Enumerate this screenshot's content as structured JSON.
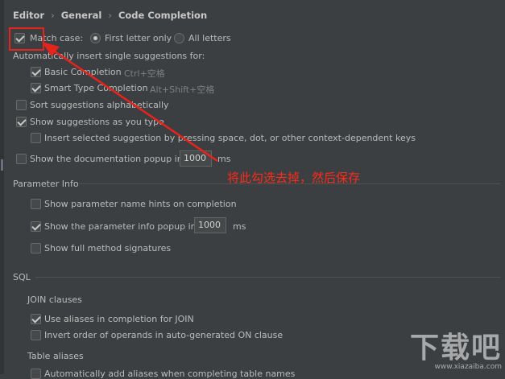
{
  "breadcrumb": {
    "items": [
      "Editor",
      "General",
      "Code Completion"
    ]
  },
  "options": {
    "match_case": {
      "label": "Match case:",
      "checked": true
    },
    "first_letter_only": {
      "label": "First letter only",
      "selected": true
    },
    "all_letters": {
      "label": "All letters",
      "selected": false
    },
    "auto_insert_heading": "Automatically insert single suggestions for:",
    "basic_completion": {
      "label": "Basic Completion",
      "shortcut": "Ctrl+空格",
      "checked": true
    },
    "smart_type_completion": {
      "label": "Smart Type Completion",
      "shortcut": "Alt+Shift+空格",
      "checked": true
    },
    "sort_alphabetically": {
      "label": "Sort suggestions alphabetically",
      "checked": false
    },
    "show_as_you_type": {
      "label": "Show suggestions as you type",
      "checked": true
    },
    "insert_selected": {
      "label": "Insert selected suggestion by pressing space, dot, or other context-dependent keys",
      "checked": false
    },
    "doc_popup": {
      "label": "Show the documentation popup in",
      "value": "1000",
      "unit": "ms",
      "checked": false
    }
  },
  "parameter_info": {
    "heading": "Parameter Info",
    "name_hints": {
      "label": "Show parameter name hints on completion",
      "checked": false
    },
    "info_popup": {
      "label": "Show the parameter info popup in",
      "value": "1000",
      "unit": "ms",
      "checked": true
    },
    "full_signatures": {
      "label": "Show full method signatures",
      "checked": false
    }
  },
  "sql": {
    "heading": "SQL",
    "join_heading": "JOIN clauses",
    "use_aliases": {
      "label": "Use aliases in completion for JOIN",
      "checked": true
    },
    "invert_order": {
      "label": "Invert order of operands in auto-generated ON clause",
      "checked": false
    },
    "table_aliases_heading": "Table aliases",
    "auto_add_aliases": {
      "label": "Automatically add aliases when completing table names",
      "checked": false
    }
  },
  "annotation": {
    "text": "将此勾选去掉，然后保存",
    "color": "#ff2a1a"
  },
  "watermark": {
    "logo": "下载吧",
    "url": "www.xiazaiba.com"
  },
  "colors": {
    "background": "#3c3f41",
    "text": "#bbbbbb",
    "hint": "#7f7f7f",
    "highlight": "#e8231b"
  }
}
